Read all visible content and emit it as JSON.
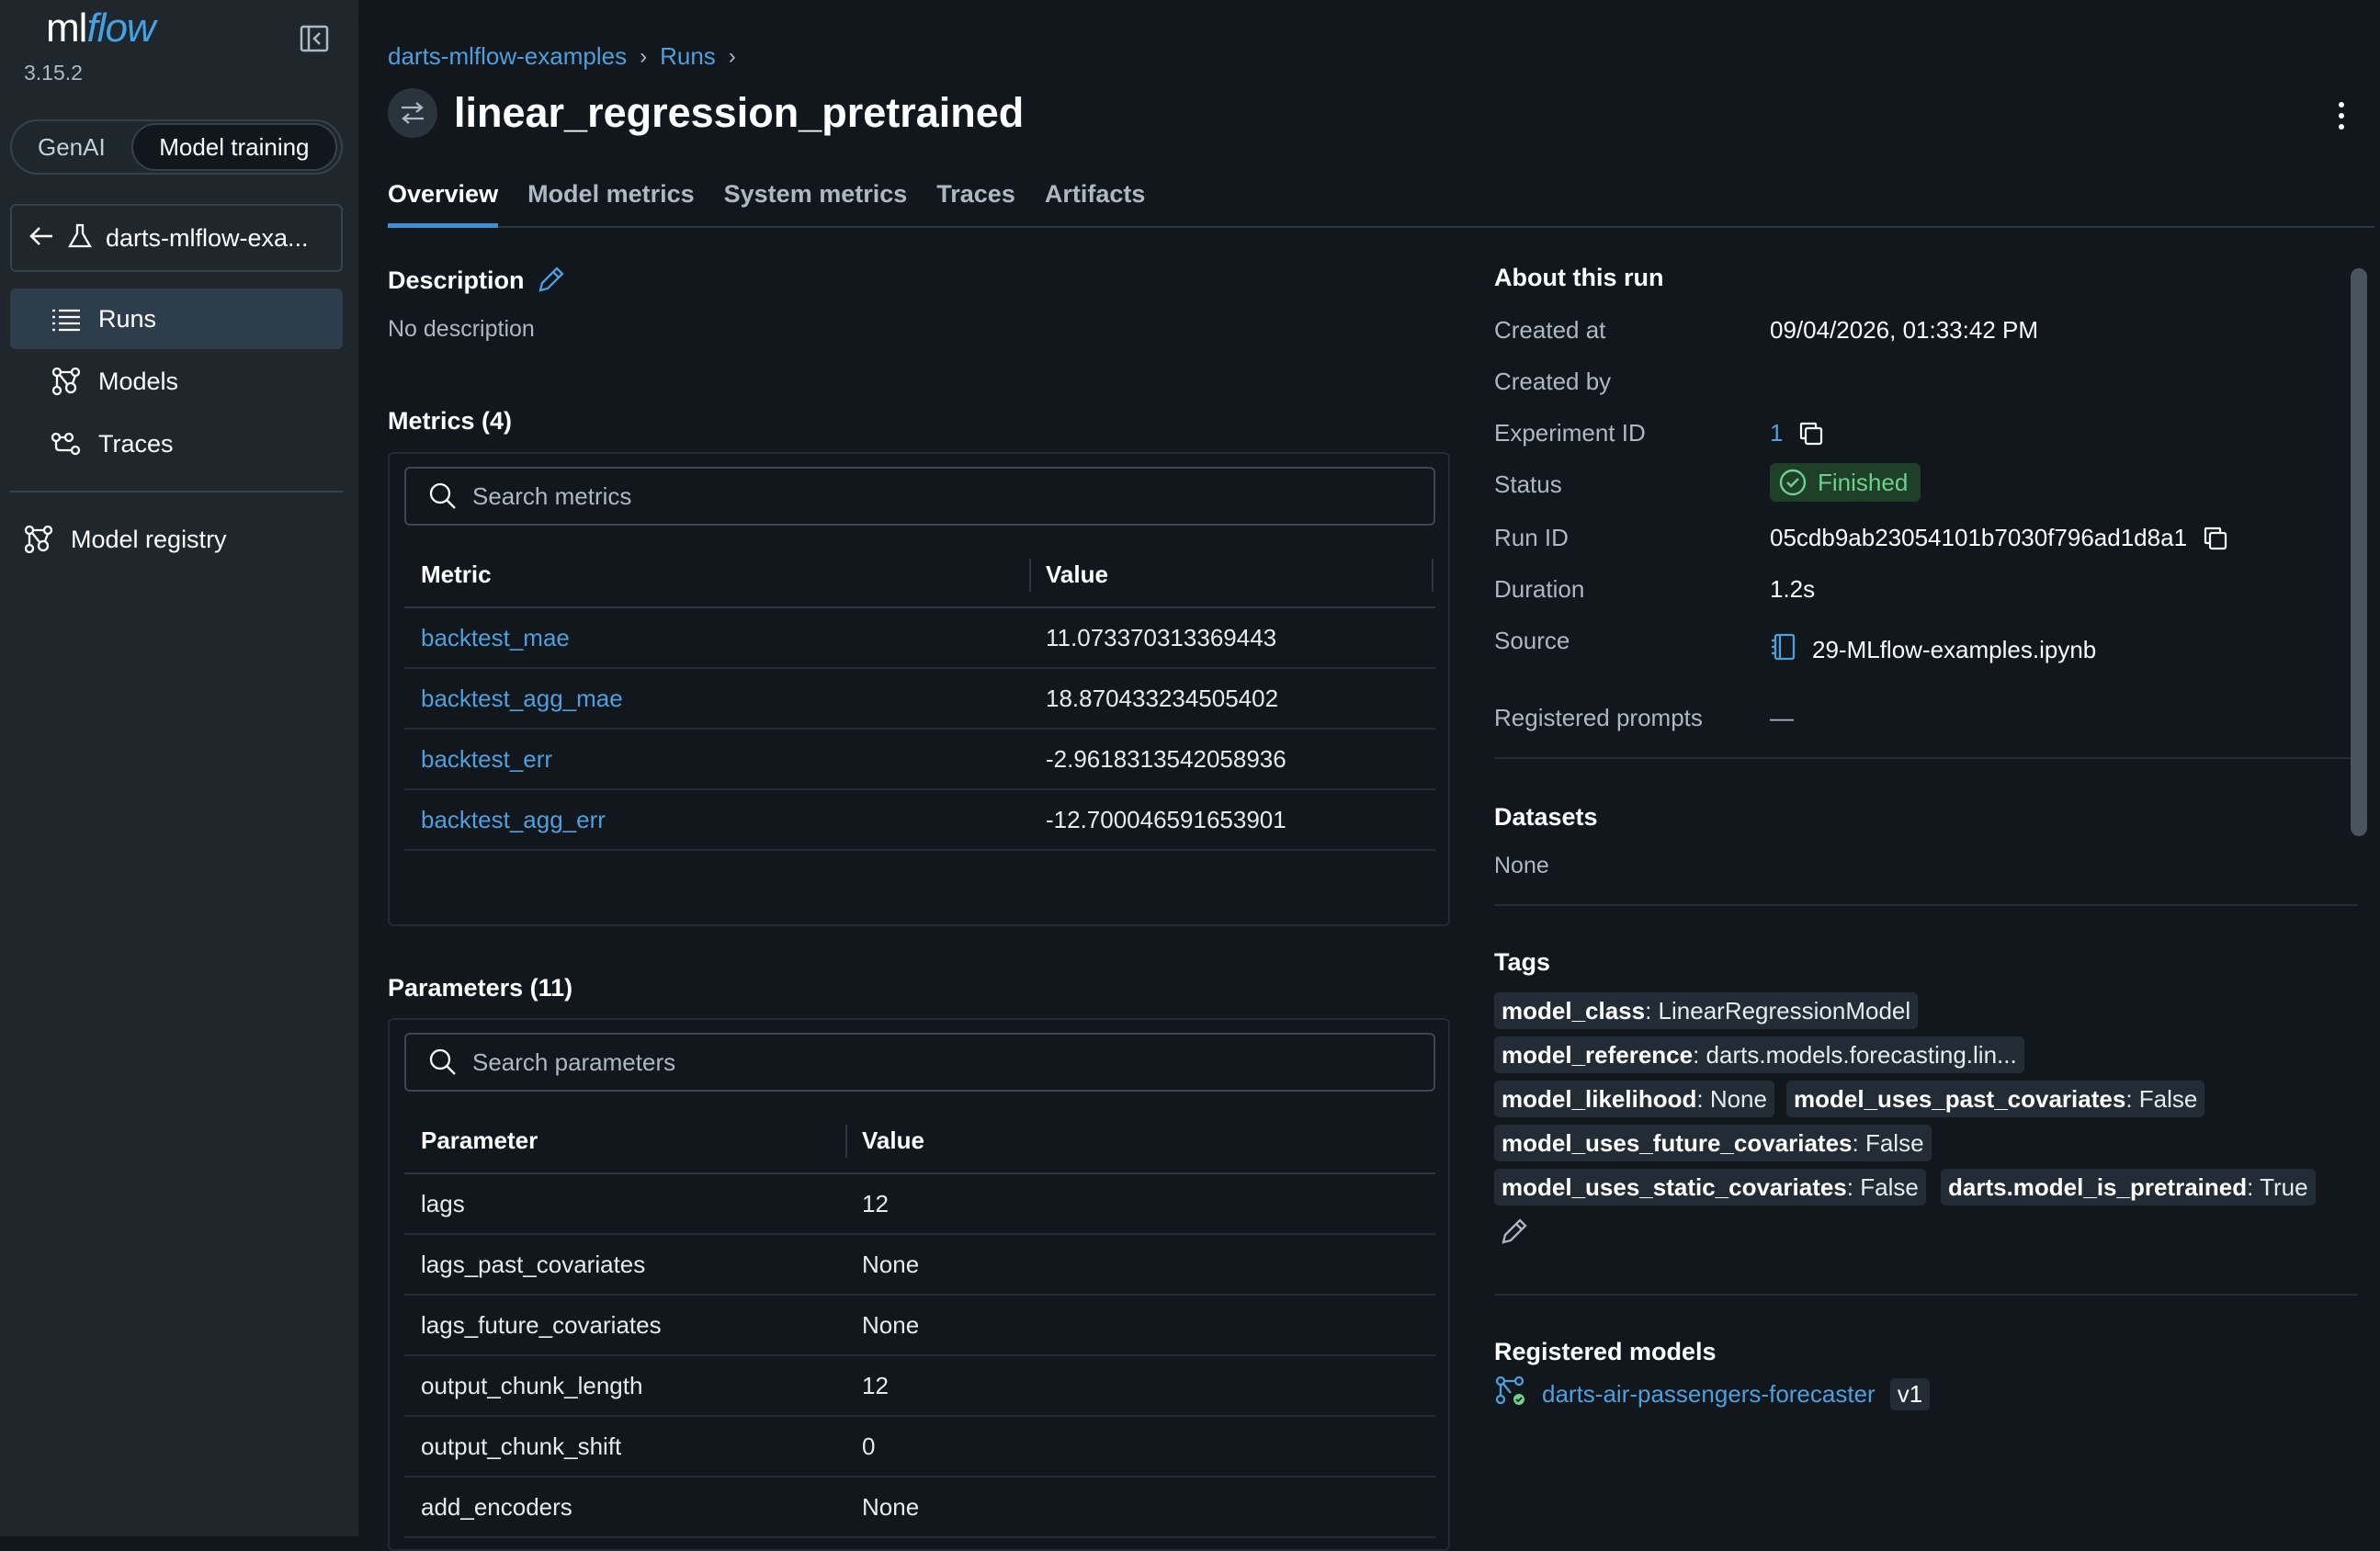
{
  "sidebar": {
    "logo_prefix": "ml",
    "logo_suffix": "flow",
    "version": "3.15.2",
    "segments": [
      "GenAI",
      "Model training"
    ],
    "experiment_name": "darts-mlflow-exa...",
    "nav": [
      {
        "label": "Runs",
        "icon": "list-icon",
        "active": true
      },
      {
        "label": "Models",
        "icon": "models-icon",
        "active": false
      },
      {
        "label": "Traces",
        "icon": "traces-icon",
        "active": false
      }
    ],
    "registry_label": "Model registry"
  },
  "header": {
    "breadcrumb": [
      "darts-mlflow-examples",
      "Runs"
    ],
    "title": "linear_regression_pretrained"
  },
  "tabs": [
    "Overview",
    "Model metrics",
    "System metrics",
    "Traces",
    "Artifacts"
  ],
  "description": {
    "title": "Description",
    "text": "No description"
  },
  "metrics": {
    "title": "Metrics (4)",
    "search_placeholder": "Search metrics",
    "columns": [
      "Metric",
      "Value"
    ],
    "rows": [
      {
        "name": "backtest_mae",
        "value": "11.073370313369443"
      },
      {
        "name": "backtest_agg_mae",
        "value": "18.870433234505402"
      },
      {
        "name": "backtest_err",
        "value": "-2.9618313542058936"
      },
      {
        "name": "backtest_agg_err",
        "value": "-12.700046591653901"
      }
    ]
  },
  "parameters": {
    "title": "Parameters (11)",
    "search_placeholder": "Search parameters",
    "columns": [
      "Parameter",
      "Value"
    ],
    "rows": [
      {
        "name": "lags",
        "value": "12"
      },
      {
        "name": "lags_past_covariates",
        "value": "None"
      },
      {
        "name": "lags_future_covariates",
        "value": "None"
      },
      {
        "name": "output_chunk_length",
        "value": "12"
      },
      {
        "name": "output_chunk_shift",
        "value": "0"
      },
      {
        "name": "add_encoders",
        "value": "None"
      }
    ]
  },
  "about": {
    "title": "About this run",
    "created_at_label": "Created at",
    "created_at": "09/04/2026, 01:33:42 PM",
    "created_by_label": "Created by",
    "experiment_id_label": "Experiment ID",
    "experiment_id": "1",
    "status_label": "Status",
    "status": "Finished",
    "status_color": "#6dd08c",
    "run_id_label": "Run ID",
    "run_id": "05cdb9ab23054101b7030f796ad1d8a1",
    "duration_label": "Duration",
    "duration": "1.2s",
    "source_label": "Source",
    "source": "29-MLflow-examples.ipynb",
    "registered_prompts_label": "Registered prompts",
    "registered_prompts": "—"
  },
  "datasets": {
    "title": "Datasets",
    "value": "None"
  },
  "tags": {
    "title": "Tags",
    "items": [
      {
        "key": "model_class",
        "value": ": LinearRegressionModel"
      },
      {
        "key": "model_reference",
        "value": ": darts.models.forecasting.lin..."
      },
      {
        "key": "model_likelihood",
        "value": ": None"
      },
      {
        "key": "model_uses_past_covariates",
        "value": ": False"
      },
      {
        "key": "model_uses_future_covariates",
        "value": ": False"
      },
      {
        "key": "model_uses_static_covariates",
        "value": ": False"
      },
      {
        "key": "darts.model_is_pretrained",
        "value": ": True"
      }
    ]
  },
  "registered_models": {
    "title": "Registered models",
    "name": "darts-air-passengers-forecaster",
    "version": "v1"
  },
  "colors": {
    "accent": "#43a2e4",
    "link": "#4f9fdc",
    "background": "#11171d",
    "sidebar": "#1f272d"
  }
}
